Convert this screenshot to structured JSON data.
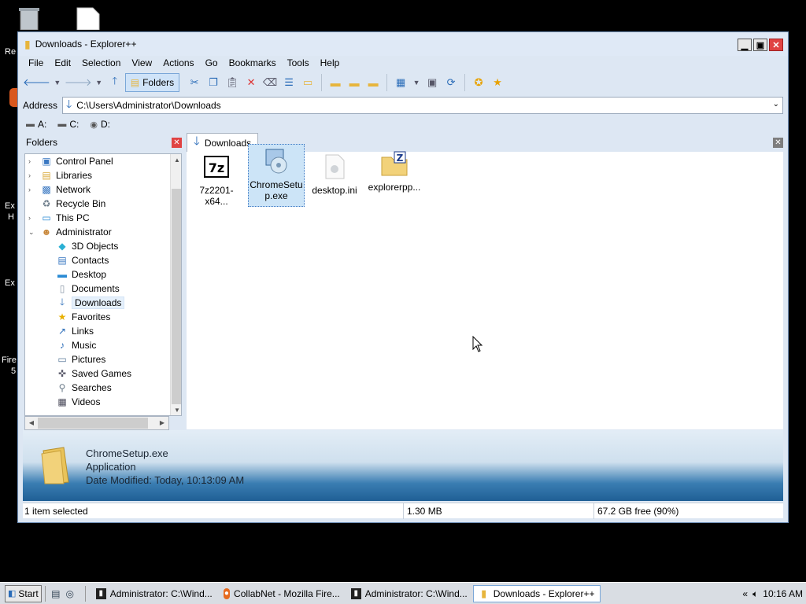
{
  "window": {
    "title": "Downloads - Explorer++"
  },
  "menu": [
    "File",
    "Edit",
    "Selection",
    "View",
    "Actions",
    "Go",
    "Bookmarks",
    "Tools",
    "Help"
  ],
  "toolbar": {
    "folders_label": "Folders"
  },
  "address": {
    "label": "Address",
    "value": "C:\\Users\\Administrator\\Downloads"
  },
  "drives": [
    "A:",
    "C:",
    "D:"
  ],
  "folders_pane": {
    "title": "Folders",
    "items": [
      {
        "label": "Control Panel",
        "icon": "control-panel-icon",
        "indent": 0,
        "expander": "›"
      },
      {
        "label": "Libraries",
        "icon": "libraries-icon",
        "indent": 0,
        "expander": "›"
      },
      {
        "label": "Network",
        "icon": "network-icon",
        "indent": 0,
        "expander": "›"
      },
      {
        "label": "Recycle Bin",
        "icon": "recycle-bin-icon",
        "indent": 0,
        "expander": ""
      },
      {
        "label": "This PC",
        "icon": "this-pc-icon",
        "indent": 0,
        "expander": "›"
      },
      {
        "label": "Administrator",
        "icon": "user-icon",
        "indent": 0,
        "expander": "⌄"
      },
      {
        "label": "3D Objects",
        "icon": "3d-objects-icon",
        "indent": 1,
        "expander": ""
      },
      {
        "label": "Contacts",
        "icon": "contacts-icon",
        "indent": 1,
        "expander": ""
      },
      {
        "label": "Desktop",
        "icon": "desktop-icon",
        "indent": 1,
        "expander": ""
      },
      {
        "label": "Documents",
        "icon": "documents-icon",
        "indent": 1,
        "expander": ""
      },
      {
        "label": "Downloads",
        "icon": "downloads-icon",
        "indent": 1,
        "expander": "",
        "selected": true
      },
      {
        "label": "Favorites",
        "icon": "favorites-icon",
        "indent": 1,
        "expander": ""
      },
      {
        "label": "Links",
        "icon": "links-icon",
        "indent": 1,
        "expander": ""
      },
      {
        "label": "Music",
        "icon": "music-icon",
        "indent": 1,
        "expander": ""
      },
      {
        "label": "Pictures",
        "icon": "pictures-icon",
        "indent": 1,
        "expander": ""
      },
      {
        "label": "Saved Games",
        "icon": "saved-games-icon",
        "indent": 1,
        "expander": ""
      },
      {
        "label": "Searches",
        "icon": "searches-icon",
        "indent": 1,
        "expander": ""
      },
      {
        "label": "Videos",
        "icon": "videos-icon",
        "indent": 1,
        "expander": ""
      }
    ]
  },
  "tab": {
    "label": "Downloads"
  },
  "files": [
    {
      "name": "7z2201-x64...",
      "icon": "7zip-icon"
    },
    {
      "name": "ChromeSetup.exe",
      "name_line1": "ChromeSetu",
      "name_line2": "p.exe",
      "icon": "installer-icon",
      "selected": true
    },
    {
      "name": "desktop.ini",
      "icon": "ini-file-icon"
    },
    {
      "name": "explorerpp...",
      "icon": "zip-folder-icon"
    }
  ],
  "info_pane": {
    "name": "ChromeSetup.exe",
    "type": "Application",
    "modified": "Date Modified: Today, 10:13:09 AM"
  },
  "status": {
    "selection": "1 item selected",
    "size": "1.30 MB",
    "free": "67.2 GB free (90%)"
  },
  "taskbar": {
    "start": "Start",
    "tasks": [
      {
        "label": "Administrator: C:\\Wind...",
        "icon": "cmd-icon"
      },
      {
        "label": "CollabNet - Mozilla Fire...",
        "icon": "firefox-icon"
      },
      {
        "label": "Administrator: C:\\Wind...",
        "icon": "cmd-icon"
      },
      {
        "label": "Downloads - Explorer++",
        "icon": "explorer-icon",
        "active": true
      }
    ],
    "clock": "10:16 AM"
  },
  "desktop_icons": [
    {
      "label": "Re"
    },
    {
      "label": "Ex"
    },
    {
      "label": "H"
    },
    {
      "label": "Ex"
    },
    {
      "label": "Fire"
    },
    {
      "label": "5"
    }
  ],
  "colors": {
    "accent": "#2a6cb8",
    "close": "#e04343",
    "selection": "#cce4f7"
  }
}
